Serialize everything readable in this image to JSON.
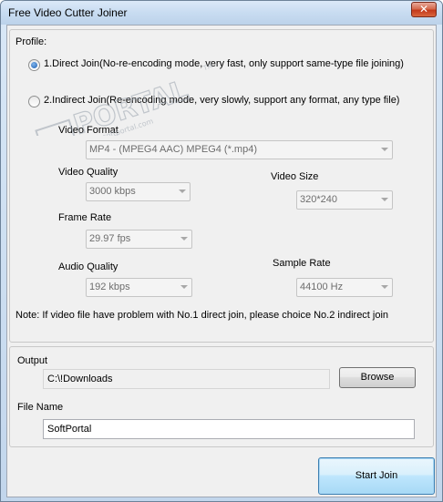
{
  "window": {
    "title": "Free Video Cutter Joiner",
    "close_glyph": "✕"
  },
  "profile": {
    "label": "Profile:",
    "option1": "1.Direct Join(No-re-encoding mode, very fast, only support same-type file joining)",
    "option2": "2.Indirect Join(Re-encoding mode, very slowly, support any format, any type file)",
    "selected": 1
  },
  "video_format": {
    "label": "Video Format",
    "value": "MP4 - (MPEG4 AAC) MPEG4 (*.mp4)"
  },
  "video_quality": {
    "label": "Video Quality",
    "value": "3000 kbps"
  },
  "video_size": {
    "label": "Video Size",
    "value": "320*240"
  },
  "frame_rate": {
    "label": "Frame Rate",
    "value": "29.97 fps"
  },
  "audio_quality": {
    "label": "Audio Quality",
    "value": "192 kbps"
  },
  "sample_rate": {
    "label": "Sample Rate",
    "value": "44100 Hz"
  },
  "note": "Note: If video file have problem with No.1 direct join, please choice No.2 indirect join",
  "output": {
    "label": "Output",
    "value": "C:\\!Downloads",
    "browse_label": "Browse"
  },
  "file_name": {
    "label": "File Name",
    "value": "SoftPortal"
  },
  "start_join_label": "Start Join",
  "watermark": {
    "text": "PORTAL",
    "url": "www.softportal.com",
    "tm": "TM"
  }
}
